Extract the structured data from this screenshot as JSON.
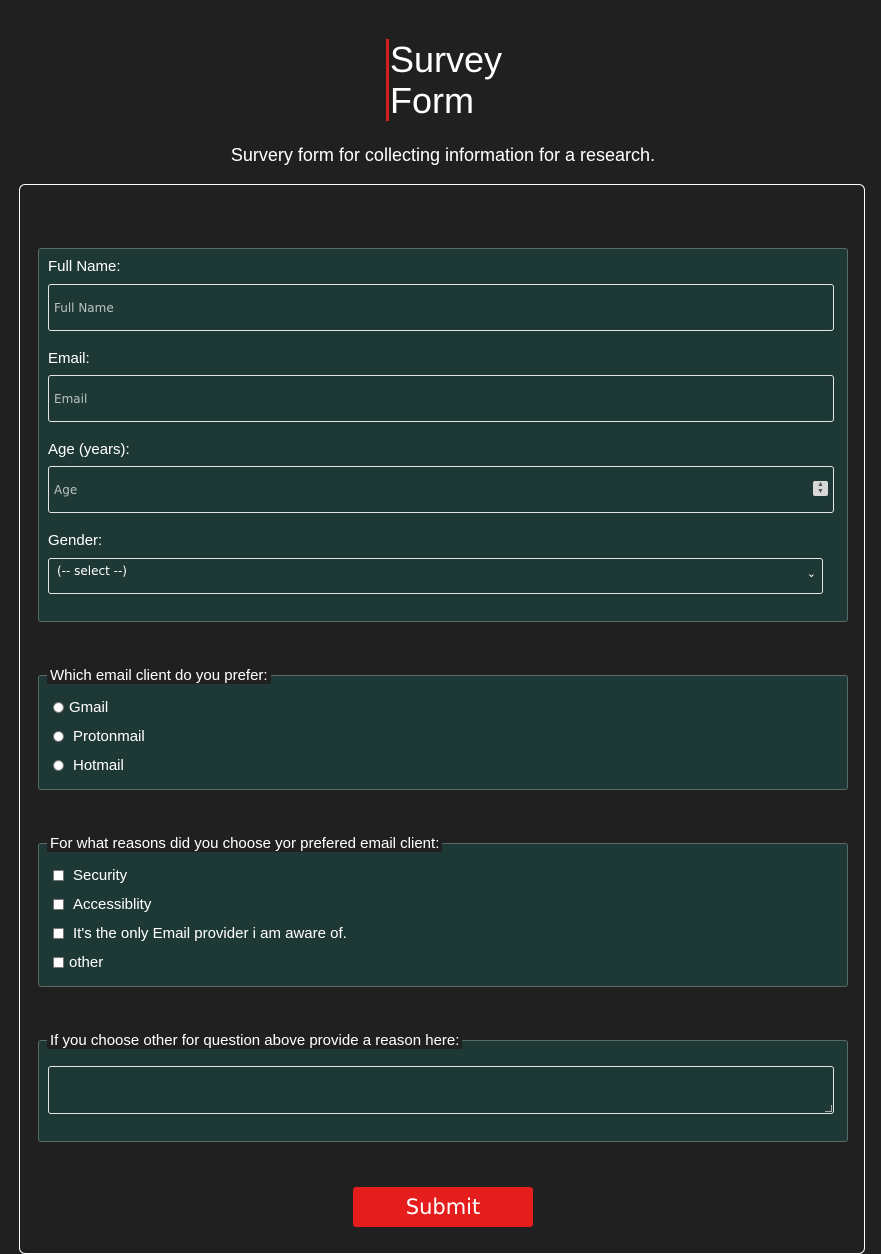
{
  "header": {
    "title": "Survey Form",
    "subtitle": "Survery form for collecting information for a research."
  },
  "personal": {
    "name_label": "Full Name:",
    "name_placeholder": "Full Name",
    "email_label": "Email:",
    "email_placeholder": "Email",
    "age_label": "Age (years):",
    "age_placeholder": "Age",
    "gender_label": "Gender:",
    "gender_selected": "(-- select --)"
  },
  "email_client": {
    "legend": "Which email client do you prefer:",
    "options": [
      "Gmail",
      "Protonmail",
      "Hotmail"
    ]
  },
  "reasons": {
    "legend": "For what reasons did you choose yor prefered email client:",
    "options": [
      "Security",
      "Accessiblity",
      "It's the only Email provider i am aware of.",
      "other"
    ]
  },
  "other_reason": {
    "legend": "If you choose other for question above provide a reason here:"
  },
  "submit_label": "Submit",
  "colors": {
    "background": "#202020",
    "panel": "#1e3835",
    "accent_red": "#e51d1d",
    "title_bar": "#d41f1f"
  }
}
